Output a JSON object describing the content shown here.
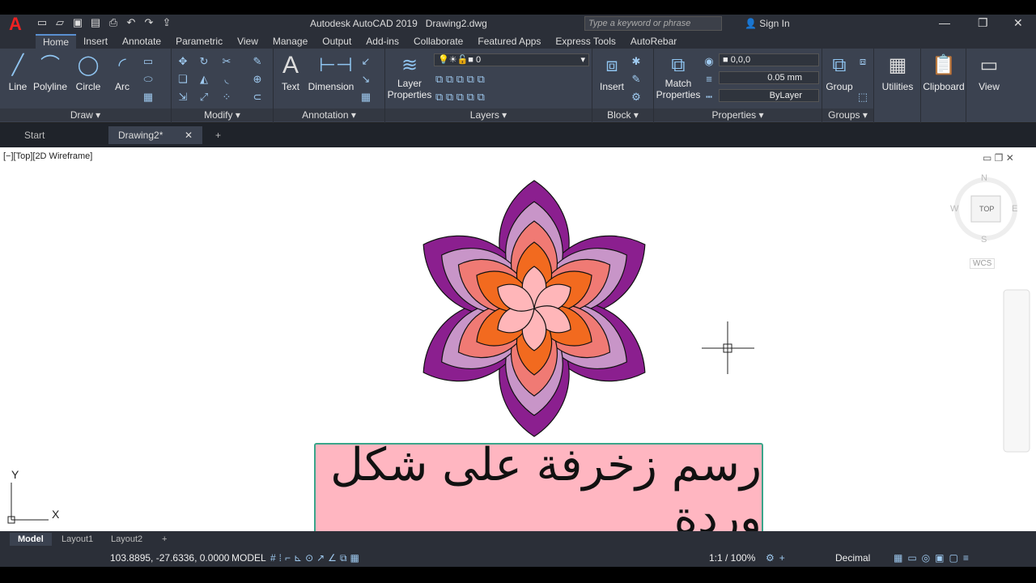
{
  "app": {
    "title": "Autodesk AutoCAD 2019",
    "file": "Drawing2.dwg",
    "search_placeholder": "Type a keyword or phrase",
    "signin": "Sign In"
  },
  "tabs": [
    "Home",
    "Insert",
    "Annotate",
    "Parametric",
    "View",
    "Manage",
    "Output",
    "Add-ins",
    "Collaborate",
    "Featured Apps",
    "Express Tools",
    "AutoRebar"
  ],
  "ribbon": {
    "draw": {
      "title": "Draw",
      "tools": [
        "Line",
        "Polyline",
        "Circle",
        "Arc"
      ]
    },
    "modify": {
      "title": "Modify"
    },
    "annotation": {
      "title": "Annotation",
      "tools": [
        "Text",
        "Dimension"
      ]
    },
    "layers": {
      "title": "Layers",
      "tool": "Layer",
      "tool2": "Properties",
      "current": "0"
    },
    "block": {
      "title": "Block",
      "tool": "Insert"
    },
    "properties": {
      "title": "Properties",
      "tool": "Match",
      "tool2": "Properties",
      "color": "0,0,0",
      "lineweight": "0.05 mm",
      "linetype": "ByLayer"
    },
    "groups": {
      "title": "Groups",
      "tool": "Group"
    },
    "utilities": "Utilities",
    "clipboard": "Clipboard",
    "view": "View"
  },
  "file_tabs": {
    "start": "Start",
    "drawing": "Drawing2*"
  },
  "viewport": {
    "label": "[−][Top][2D Wireframe]"
  },
  "viewcube": {
    "n": "N",
    "s": "S",
    "e": "E",
    "w": "W",
    "top": "TOP",
    "wcs": "WCS"
  },
  "ucs": {
    "x": "X",
    "y": "Y"
  },
  "caption": "رسم زخرفة على شكل وردة",
  "layout_tabs": [
    "Model",
    "Layout1",
    "Layout2"
  ],
  "status": {
    "coords": "103.8895, -27.6336, 0.0000",
    "model": "MODEL",
    "scale": "1:1 / 100%",
    "units": "Decimal"
  },
  "colors": {
    "petal_outer": "#8b1f8f",
    "petal_2": "#c895c8",
    "petal_3": "#f07a74",
    "petal_4": "#f26a1f",
    "petal_inner": "#ffb6b9",
    "caption_bg": "#ffb6c1"
  }
}
